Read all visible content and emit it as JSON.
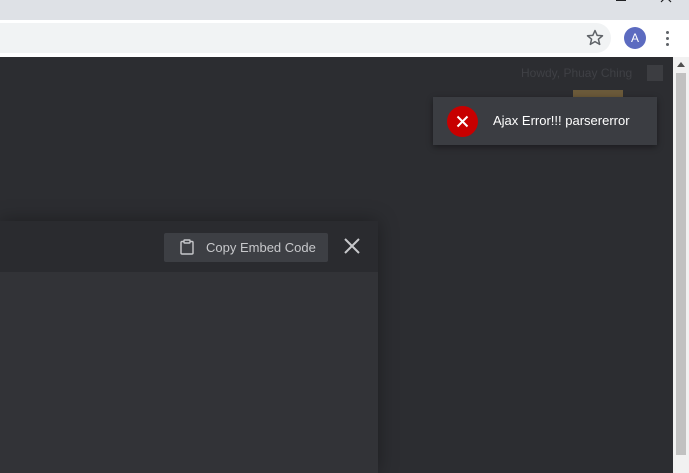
{
  "browser": {
    "profile_initial": "A",
    "avatar_color": "#5c6bc0"
  },
  "page": {
    "greeting": "Howdy, Phuay Ching"
  },
  "toast": {
    "message": "Ajax Error!!! parsererror",
    "icon": "error-x-icon",
    "icon_color": "#c70000"
  },
  "modal": {
    "copy_button_label": "Copy Embed Code",
    "copy_icon": "clipboard-icon",
    "close_icon": "close-icon"
  }
}
